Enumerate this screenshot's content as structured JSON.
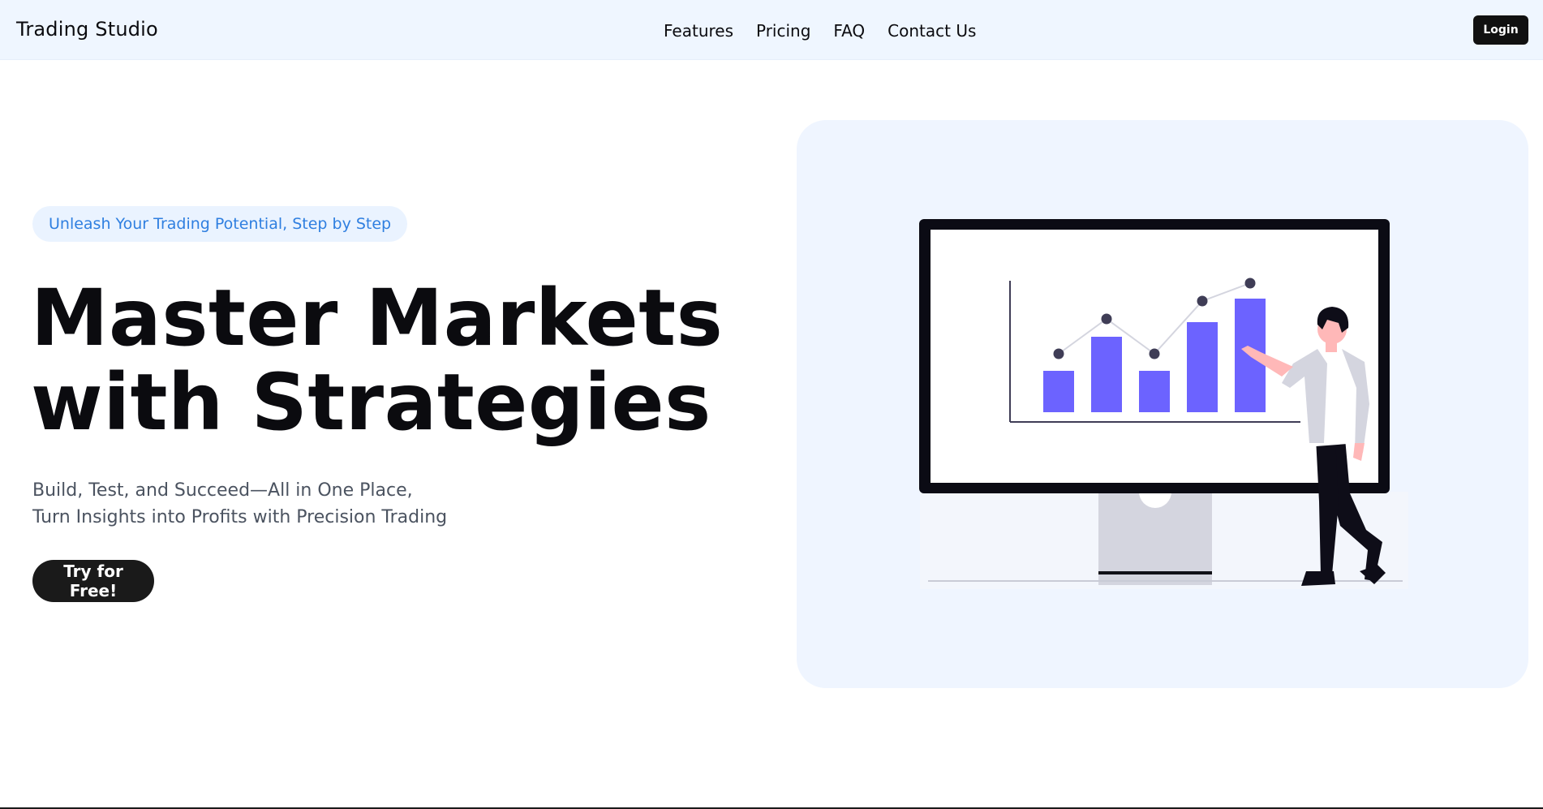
{
  "header": {
    "brand": "Trading Studio",
    "nav": [
      "Features",
      "Pricing",
      "FAQ",
      "Contact Us"
    ],
    "login_label": "Login"
  },
  "hero": {
    "tagline": "Unleash Your Trading Potential, Step by Step",
    "title_lines": [
      "Master Markets",
      "with Strategies"
    ],
    "subtitle_lines": [
      "Build, Test, and Succeed—All in One Place,",
      "Turn Insights into Profits with Precision Trading"
    ],
    "cta_label": "Try for Free!"
  },
  "colors": {
    "nav_bg": "#eff6ff",
    "accent_blue": "#2f7fe0",
    "bar_purple": "#6c63ff",
    "dark": "#111111"
  },
  "icons": {
    "illustration": "person-presenting-chart-icon"
  }
}
